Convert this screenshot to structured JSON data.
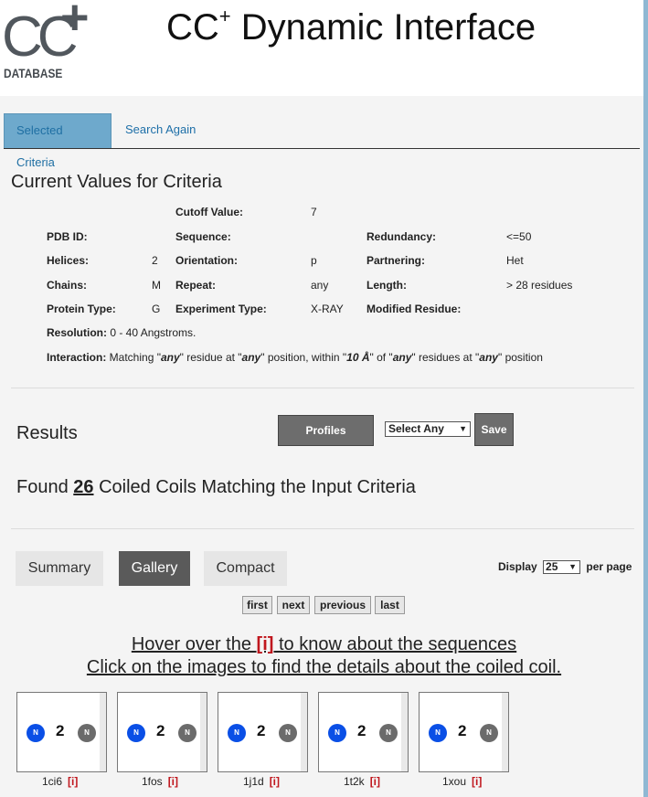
{
  "header": {
    "logo_text": "CC",
    "logo_plus": "+",
    "logo_sub": "DATABASE",
    "title_main": "CC",
    "title_sup": "+",
    "title_rest": " Dynamic Interface"
  },
  "tabs": [
    {
      "label": "Selected Criteria"
    },
    {
      "label": "Search Again"
    }
  ],
  "criteria": {
    "heading": "Current Values for Criteria",
    "cutoff_label": "Cutoff Value:",
    "cutoff_value": "7",
    "pdb_label": "PDB ID:",
    "sequence_label": "Sequence:",
    "redundancy_label": "Redundancy:",
    "redundancy_value": "<=50",
    "helices_label": "Helices:",
    "helices_value": "2",
    "orientation_label": "Orientation:",
    "orientation_value": "p",
    "partnering_label": "Partnering:",
    "partnering_value": "Het",
    "chains_label": "Chains:",
    "chains_value": "M",
    "repeat_label": "Repeat:",
    "repeat_value": "any",
    "length_label": "Length:",
    "length_value": "> 28 residues",
    "protein_label": "Protein Type:",
    "protein_value": "G",
    "experiment_label": "Experiment Type:",
    "experiment_value": "X-RAY",
    "modified_label": "Modified Residue:",
    "resolution_label": "Resolution:",
    "resolution_value": "0 - 40 Angstroms.",
    "interaction_label": "Interaction:",
    "interaction_p1": " Matching \"",
    "interaction_any1": "any",
    "interaction_p2": "\" residue at \"",
    "interaction_any2": "any",
    "interaction_p3": "\" position, within \"",
    "interaction_dist": "10 Å",
    "interaction_p4": "\" of \"",
    "interaction_any3": "any",
    "interaction_p5": "\" residues at \"",
    "interaction_any4": "any",
    "interaction_p6": "\" position"
  },
  "results": {
    "heading": "Results",
    "profiles_label": "Profiles",
    "select_value": "Select Any",
    "save_label": "Save",
    "found_prefix": "Found ",
    "found_count": "26",
    "found_suffix": " Coiled Coils Matching the Input Criteria"
  },
  "views": {
    "summary": "Summary",
    "gallery": "Gallery",
    "compact": "Compact",
    "display_label": "Display",
    "per_page_value": "25",
    "per_page_label": "per page"
  },
  "pager": {
    "first": "first",
    "next": "next",
    "previous": "previous",
    "last": "last"
  },
  "hint": {
    "line1_pre": "Hover over the ",
    "line1_i": "[i]",
    "line1_post": " to know about the sequences",
    "line2": "Click on the images to find the details about the coiled coil."
  },
  "gallery": [
    {
      "id": "1ci6",
      "n_left": "N",
      "count": "2",
      "n_right": "N",
      "info": "[i]"
    },
    {
      "id": "1fos",
      "n_left": "N",
      "count": "2",
      "n_right": "N",
      "info": "[i]"
    },
    {
      "id": "1j1d",
      "n_left": "N",
      "count": "2",
      "n_right": "N",
      "info": "[i]"
    },
    {
      "id": "1t2k",
      "n_left": "N",
      "count": "2",
      "n_right": "N",
      "info": "[i]"
    },
    {
      "id": "1xou",
      "n_left": "N",
      "count": "2",
      "n_right": "N",
      "info": "[i]"
    }
  ],
  "colors": {
    "accent": "#6ea9cc",
    "link": "#1e6fa8",
    "info_red": "#c0171e",
    "n_blue": "#0a4fe6",
    "n_gray": "#6b6b6b"
  }
}
